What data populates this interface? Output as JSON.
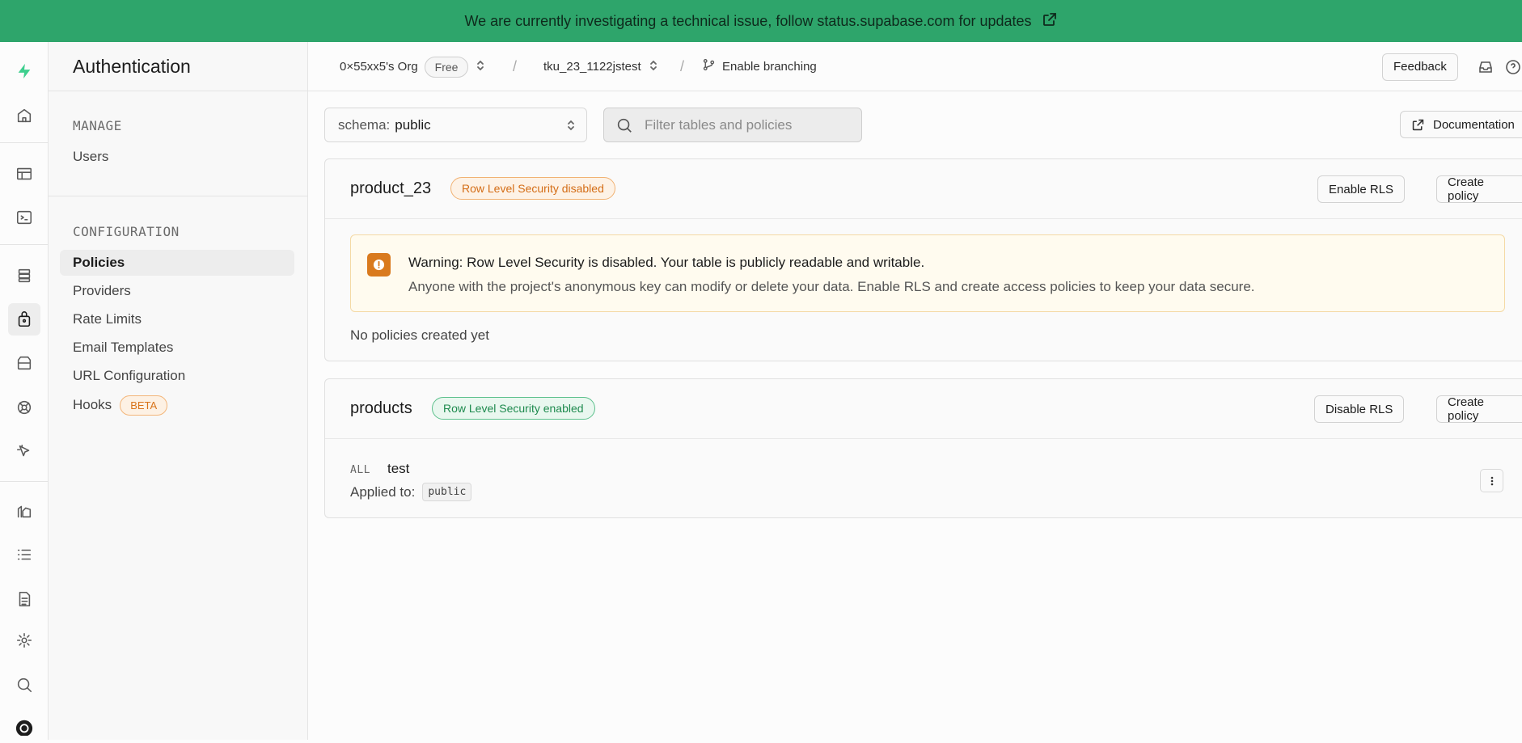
{
  "banner": {
    "text": "We are currently investigating a technical issue, follow status.supabase.com for updates"
  },
  "sidebar": {
    "title": "Authentication",
    "manage_label": "MANAGE",
    "manage_items": [
      "Users"
    ],
    "config_label": "CONFIGURATION",
    "config_items": [
      "Policies",
      "Providers",
      "Rate Limits",
      "Email Templates",
      "URL Configuration",
      "Hooks"
    ],
    "hooks_badge": "BETA",
    "active_item": "Policies"
  },
  "topbar": {
    "org": "0×55xx5's Org",
    "plan": "Free",
    "project": "tku_23_1122jstest",
    "branching": "Enable branching",
    "feedback": "Feedback"
  },
  "toolbar": {
    "schema_label": "schema:",
    "schema_value": "public",
    "search_placeholder": "Filter tables and policies",
    "documentation": "Documentation"
  },
  "tables": [
    {
      "name": "product_23",
      "rls_badge": "Row Level Security disabled",
      "toggle_button": "Enable RLS",
      "create_button": "Create policy",
      "warning_title": "Warning: Row Level Security is disabled. Your table is publicly readable and writable.",
      "warning_body": "Anyone with the project's anonymous key can modify or delete your data. Enable RLS and create access policies to keep your data secure.",
      "empty_text": "No policies created yet"
    },
    {
      "name": "products",
      "rls_badge": "Row Level Security enabled",
      "toggle_button": "Disable RLS",
      "create_button": "Create policy",
      "policies": [
        {
          "command": "ALL",
          "name": "test",
          "applied_label": "Applied to:",
          "role": "public"
        }
      ]
    }
  ],
  "colors": {
    "banner": "#2ea56b",
    "warn": "#d46d16",
    "ok": "#1e8a4e"
  }
}
